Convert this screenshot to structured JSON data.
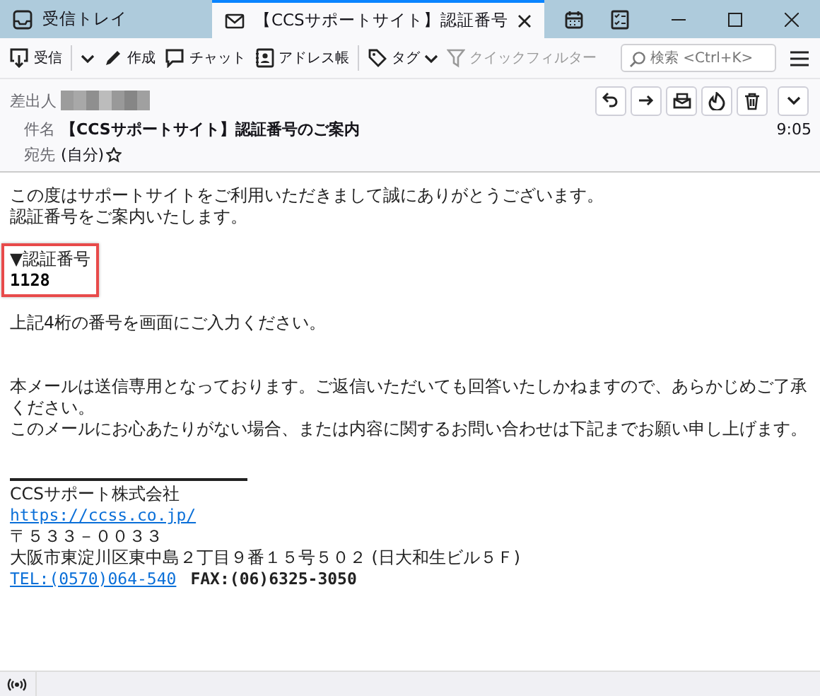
{
  "tabs": [
    {
      "kind": "inbox",
      "label": "受信トレイ",
      "selected": false
    },
    {
      "kind": "mail",
      "label": "【CCSサポートサイト】認証番号",
      "selected": true
    }
  ],
  "toolbar": {
    "buttons": [
      {
        "kind": "get",
        "label": "受信",
        "dropdown": true,
        "disabled": false
      },
      {
        "kind": "write",
        "label": "作成",
        "dropdown": false,
        "disabled": false
      },
      {
        "kind": "chat",
        "label": "チャット",
        "dropdown": false,
        "disabled": false
      },
      {
        "kind": "address",
        "label": "アドレス帳",
        "dropdown": false,
        "disabled": false
      },
      {
        "kind": "tag",
        "label": "タグ",
        "dropdown": true,
        "disabled": false
      },
      {
        "kind": "filter",
        "label": "クイックフィルター",
        "dropdown": false,
        "disabled": true
      }
    ],
    "search": {
      "placeholder": "検索 <Ctrl+K>"
    }
  },
  "header": {
    "from_label": "差出人",
    "subject_label": "件名",
    "subject": "【CCSサポートサイト】認証番号のご案内",
    "time": "9:05",
    "to_label": "宛先",
    "to": "(自分)",
    "to_starred": false
  },
  "body": [
    {
      "kind": "text",
      "text": "この度はサポートサイトをご利用いただきまして誠にありがとうございます。"
    },
    {
      "kind": "text",
      "text": "認証番号をご案内いたします。"
    },
    {
      "kind": "gap"
    },
    {
      "kind": "boxed",
      "lines": [
        {
          "text": "▼認証番号",
          "bold": false
        },
        {
          "text": "1128",
          "bold": true
        }
      ]
    },
    {
      "kind": "gap"
    },
    {
      "kind": "text",
      "text": "上記4桁の番号を画面にご入力ください。"
    },
    {
      "kind": "gap"
    },
    {
      "kind": "gap"
    },
    {
      "kind": "text",
      "text": "本メールは送信専用となっております。ご返信いただいても回答いたしかねますので、あらかじめご了承ください。"
    },
    {
      "kind": "text",
      "text": "このメールにお心あたりがない場合、または内容に関するお問い合わせは下記までお願い申し上げます。"
    },
    {
      "kind": "gap"
    },
    {
      "kind": "rule"
    },
    {
      "kind": "text",
      "text": "CCSサポート株式会社"
    },
    {
      "kind": "link",
      "text": "https://ccss.co.jp/"
    },
    {
      "kind": "text",
      "text": "〒５３３－００３３"
    },
    {
      "kind": "text",
      "text": "大阪市東淀川区東中島２丁目９番１５号５０２ (日大和生ビル５Ｆ)"
    },
    {
      "kind": "contact",
      "link": "TEL:(0570)064-540",
      "text": "FAX:(06)6325-3050"
    }
  ]
}
